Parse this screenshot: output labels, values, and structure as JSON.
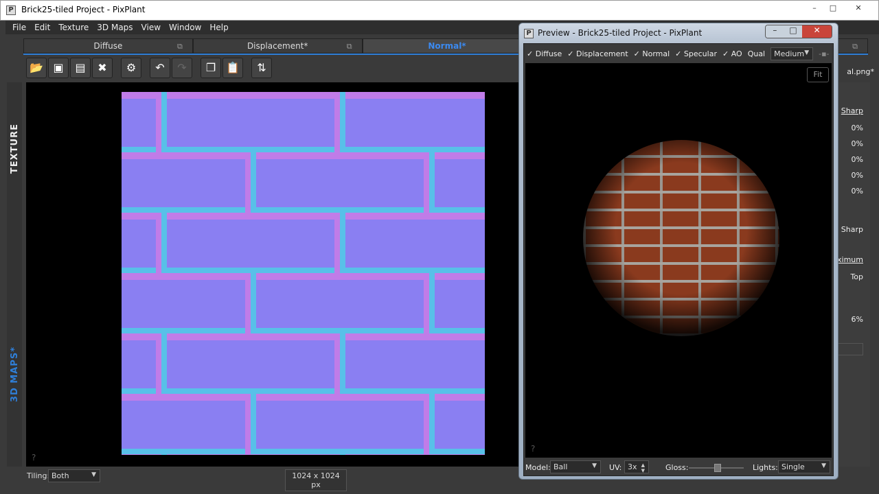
{
  "window": {
    "title": "Brick25-tiled Project - PixPlant",
    "minimize": "–",
    "maximize": "□",
    "close": "✕"
  },
  "menu": [
    "File",
    "Edit",
    "Texture",
    "3D Maps",
    "View",
    "Window",
    "Help"
  ],
  "tabs": [
    {
      "label": "Diffuse"
    },
    {
      "label": "Displacement*"
    },
    {
      "label": "Normal*",
      "active": true
    }
  ],
  "toolbar": [
    "open-folder-icon",
    "save-icon",
    "save-as-icon",
    "close-x-icon",
    "settings-gear-icon",
    "undo-icon",
    "redo-icon",
    "copy-icon",
    "paste-icon",
    "swap-arrows-icon"
  ],
  "side": {
    "texture": "TEXTURE",
    "maps": "3D MAPS*"
  },
  "canvas": {
    "help": "?",
    "tiling_label": "Tiling:",
    "tiling_value": "Both",
    "size": "1024 x 1024 px"
  },
  "right_panel": {
    "filename": "al.png*",
    "sharp1": "Sharp",
    "pcts": [
      "0%",
      "0%",
      "0%",
      "0%",
      "0%"
    ],
    "sharp2": "Sharp",
    "maximum": "aximum",
    "top": "Top",
    "pct6": "6%"
  },
  "preview": {
    "title": "Preview - Brick25-tiled Project - PixPlant",
    "checks": [
      {
        "label": "Diffuse",
        "checked": true
      },
      {
        "label": "Displacement",
        "checked": true
      },
      {
        "label": "Normal",
        "checked": true
      },
      {
        "label": "Specular",
        "checked": true
      },
      {
        "label": "AO",
        "checked": true
      }
    ],
    "qual_label": "Qual",
    "qual_value": "Medium",
    "fit": "Fit",
    "help": "?",
    "model_label": "Model:",
    "model_value": "Ball",
    "uv_label": "UV:",
    "uv_value": "3x",
    "gloss_label": "Gloss:",
    "gloss_value": 0.52,
    "lights_label": "Lights:",
    "lights_value": "Single"
  },
  "colors": {
    "accent": "#2f7fd8",
    "normal_map": "#8a7ff2",
    "brick": "#8a3a1e"
  }
}
